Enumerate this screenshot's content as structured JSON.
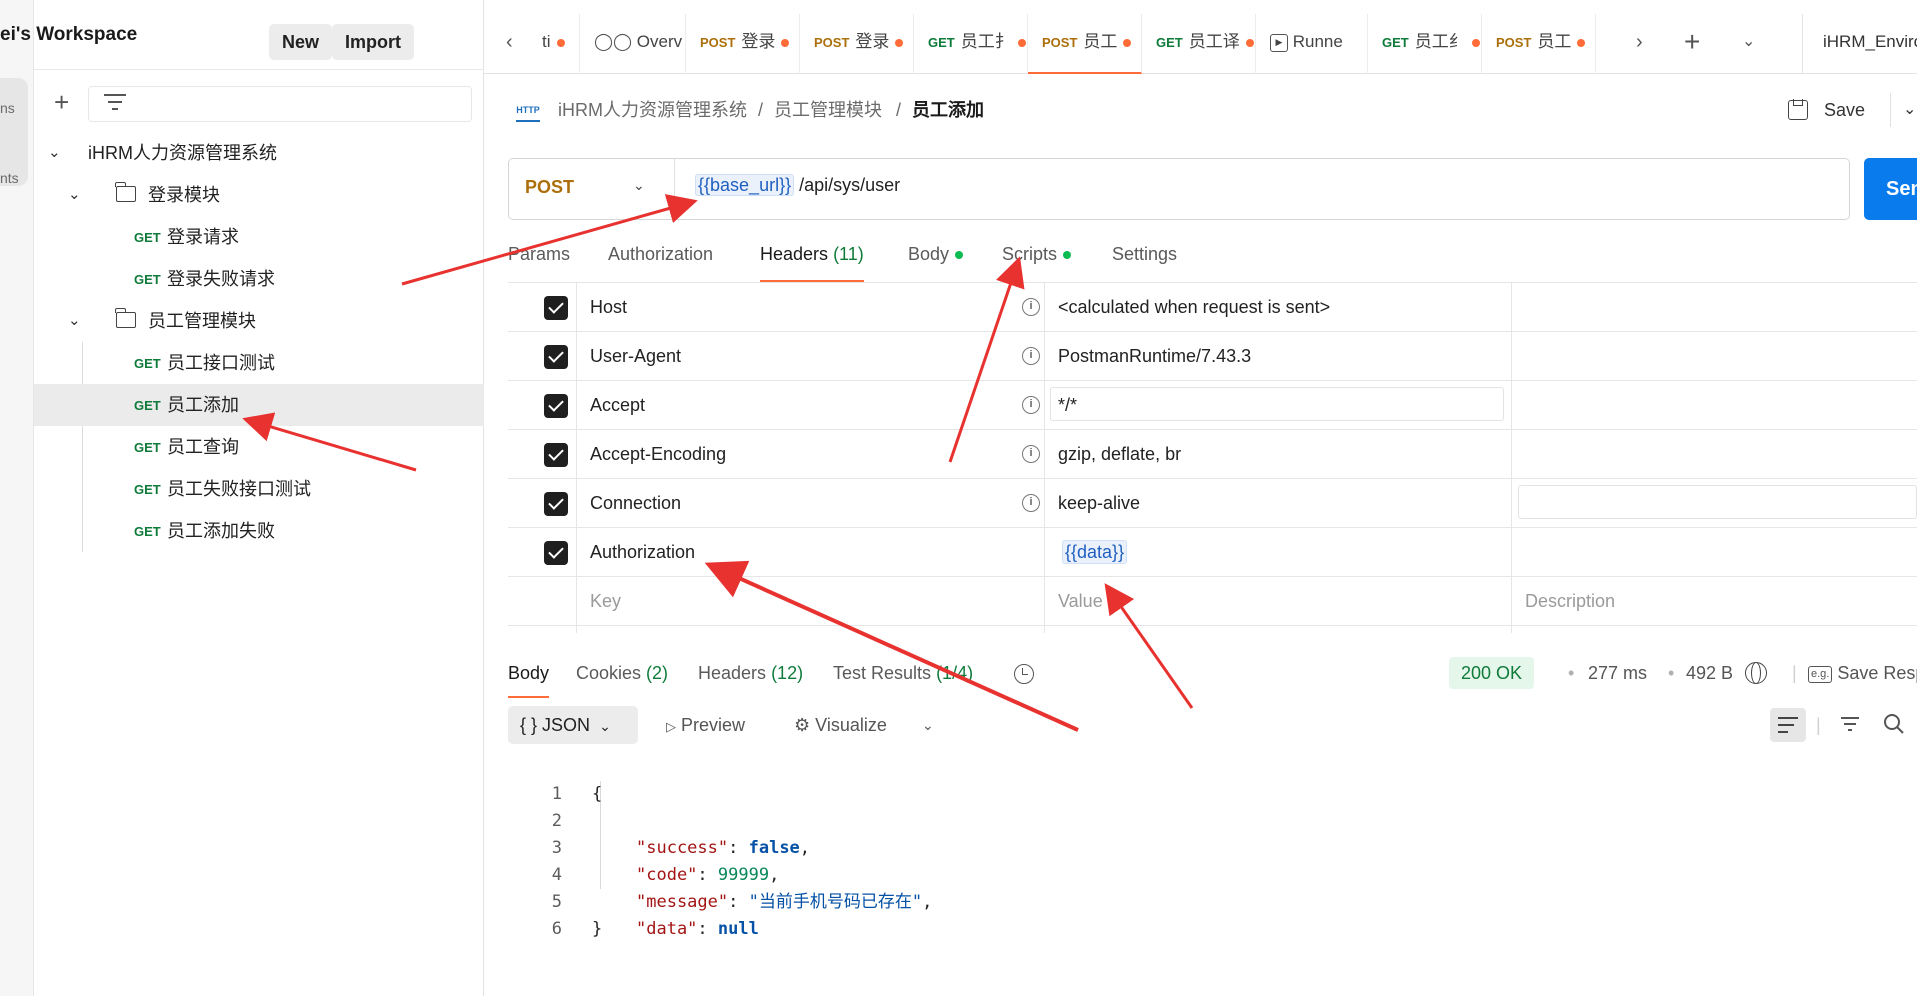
{
  "rail": {
    "items": [
      "ns",
      "nts"
    ]
  },
  "sidebar": {
    "workspace_title": "ei's Workspace",
    "new_label": "New",
    "import_label": "Import",
    "tree": {
      "collection": "iHRM人力资源管理系统",
      "folders": [
        {
          "name": "登录模块",
          "requests": [
            {
              "method": "GET",
              "name": "登录请求"
            },
            {
              "method": "GET",
              "name": "登录失败请求"
            }
          ]
        },
        {
          "name": "员工管理模块",
          "requests": [
            {
              "method": "GET",
              "name": "员工接口测试"
            },
            {
              "method": "GET",
              "name": "员工添加"
            },
            {
              "method": "GET",
              "name": "员工查询"
            },
            {
              "method": "GET",
              "name": "员工失败接口测试"
            },
            {
              "method": "GET",
              "name": "员工添加失败"
            }
          ]
        }
      ]
    }
  },
  "tabs": [
    {
      "method": "",
      "label": "ti"
    },
    {
      "method": "",
      "label": "Overv"
    },
    {
      "method": "POST",
      "label": "登录"
    },
    {
      "method": "POST",
      "label": "登录"
    },
    {
      "method": "GET",
      "label": "员工扌"
    },
    {
      "method": "POST",
      "label": "员工"
    },
    {
      "method": "GET",
      "label": "员工译"
    },
    {
      "method": "",
      "label": "Runne"
    },
    {
      "method": "GET",
      "label": "员工纟"
    },
    {
      "method": "POST",
      "label": "员工"
    }
  ],
  "environment": "iHRM_Environment",
  "breadcrumb": {
    "icon_text": "HTTP",
    "items": [
      "iHRM人力资源管理系统",
      "员工管理模块",
      "员工添加"
    ],
    "separator": "/"
  },
  "save_label": "Save",
  "request": {
    "method": "POST",
    "url_var": "{{base_url}}",
    "url_path": "/api/sys/user",
    "send_label": "Send"
  },
  "request_tabs": {
    "params": "Params",
    "authorization": "Authorization",
    "headers": "Headers",
    "headers_count": "(11)",
    "body": "Body",
    "scripts": "Scripts",
    "settings": "Settings"
  },
  "headers": [
    {
      "key": "Host",
      "value": "<calculated when request is sent>",
      "checked": true
    },
    {
      "key": "User-Agent",
      "value": "PostmanRuntime/7.43.3",
      "checked": true
    },
    {
      "key": "Accept",
      "value": "*/*",
      "checked": true
    },
    {
      "key": "Accept-Encoding",
      "value": "gzip, deflate, br",
      "checked": true
    },
    {
      "key": "Connection",
      "value": "keep-alive",
      "checked": true
    },
    {
      "key": "Authorization",
      "value": "{{data}}",
      "checked": true
    }
  ],
  "headers_placeholder": {
    "key": "Key",
    "value": "Value",
    "description": "Description"
  },
  "response": {
    "tabs": {
      "body": "Body",
      "cookies": "Cookies",
      "cookies_count": "(2)",
      "headers": "Headers",
      "headers_count": "(12)",
      "tests": "Test Results",
      "tests_count": "(1/4)"
    },
    "status": "200 OK",
    "time": "277 ms",
    "size": "492 B",
    "save_label": "Save Resp",
    "format": "JSON",
    "format_glyph": "{ }",
    "preview_label": "Preview",
    "visualize_label": "Visualize",
    "body_lines": [
      {
        "n": "1",
        "text": "{"
      },
      {
        "n": "2",
        "key": "\"success\"",
        "val": "false",
        "type": "bool"
      },
      {
        "n": "3",
        "key": "\"code\"",
        "val": "99999",
        "type": "num"
      },
      {
        "n": "4",
        "key": "\"message\"",
        "val": "\"当前手机号码已存在\"",
        "type": "str"
      },
      {
        "n": "5",
        "key": "\"data\"",
        "val": "null",
        "type": "bool"
      },
      {
        "n": "6",
        "text": "}"
      }
    ]
  },
  "icons": {
    "plus": "plus-icon",
    "filter": "filter-icon",
    "folder": "folder-icon",
    "chevron": "chevron-down-icon",
    "save": "save-icon",
    "info": "info-icon",
    "globe": "globe-icon",
    "history": "history-icon",
    "wrap": "wrap-lines-icon",
    "search": "search-icon"
  },
  "colors": {
    "accent": "#ff6c37",
    "send": "#097bed",
    "get": "#0f7b3a",
    "post": "#ab6f0b",
    "annotation_arrow": "#e8322f"
  }
}
